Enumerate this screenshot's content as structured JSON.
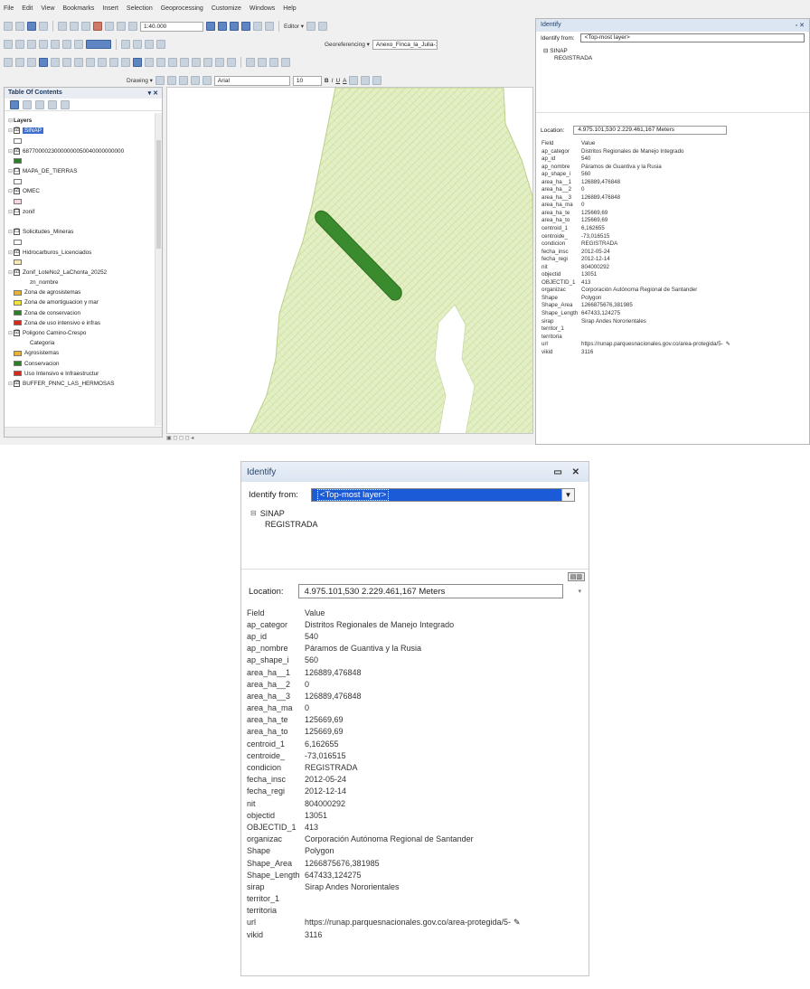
{
  "menu": [
    "File",
    "Edit",
    "View",
    "Bookmarks",
    "Insert",
    "Selection",
    "Geoprocessing",
    "Customize",
    "Windows",
    "Help"
  ],
  "toolbar": {
    "scale": "1:40.000",
    "editor_label": "Editor ▾",
    "georef_label": "Georeferencing ▾",
    "georef_layer": "Anexo_Finca_la_Julia-1",
    "drawing_label": "Drawing ▾",
    "font_name": "Arial",
    "font_size": "10"
  },
  "toc": {
    "title": "Table Of Contents",
    "pin": "▾ ✕",
    "rows": [
      {
        "exp": "⊟",
        "cb": "",
        "text": "Layers",
        "bold": true
      },
      {
        "exp": "⊟",
        "cb": "☑",
        "text": "SINAP",
        "highlight": true
      },
      {
        "exp": "",
        "sym": "#ffffff",
        "text": ""
      },
      {
        "exp": "⊟",
        "cb": "☑",
        "text": "68770000230000000050040000000000"
      },
      {
        "exp": "",
        "sym": "#2f7d2b",
        "text": ""
      },
      {
        "exp": "⊟",
        "cb": "☐",
        "text": "MAPA_DE_TIERRAS"
      },
      {
        "exp": "",
        "sym": "#ffffff",
        "text": ""
      },
      {
        "exp": "⊟",
        "cb": "☑",
        "text": "OMEC"
      },
      {
        "exp": "",
        "sym": "#f7d7e4",
        "text": ""
      },
      {
        "exp": "⊟",
        "cb": "☐",
        "text": "zonif"
      },
      {
        "exp": "",
        "text": ""
      },
      {
        "exp": "⊟",
        "cb": "☐",
        "text": "Solicitudes_Mineras"
      },
      {
        "exp": "",
        "sym": "#ffffff",
        "text": ""
      },
      {
        "exp": "⊟",
        "cb": "☑",
        "text": "Hidrocarburos_Licenciados"
      },
      {
        "exp": "",
        "sym": "#f6e7b5",
        "text": ""
      },
      {
        "exp": "⊟",
        "cb": "☑",
        "text": "Zonif_LoteNo2_LaChonta_20252"
      },
      {
        "exp": "",
        "text": "zn_nombre",
        "indent": true
      },
      {
        "exp": "",
        "sym": "#e8b23a",
        "text": "Zona de agrosistemas"
      },
      {
        "exp": "",
        "sym": "#f4e23a",
        "text": "Zona de amortiguacion y mar"
      },
      {
        "exp": "",
        "sym": "#2f7d2b",
        "text": "Zona de conservacion"
      },
      {
        "exp": "",
        "sym": "#d52a1e",
        "text": "Zona de uso intensivo e infras"
      },
      {
        "exp": "⊟",
        "cb": "☑",
        "text": "Poligono Camino-Crespo"
      },
      {
        "exp": "",
        "text": "Categoria",
        "indent": true
      },
      {
        "exp": "",
        "sym": "#e8b23a",
        "text": "Agrosistemas"
      },
      {
        "exp": "",
        "sym": "#2f7d2b",
        "text": "Conservacion"
      },
      {
        "exp": "",
        "sym": "#d52a1e",
        "text": "Uso Intensivo e Infraestructur"
      },
      {
        "exp": "⊟",
        "cb": "☑",
        "text": "BUFFER_PNNC_LAS_HERMOSAS"
      }
    ]
  },
  "map_status": "▣ ◻ ◻ ◻ ◂",
  "identify_small": {
    "title": "Identify",
    "controls": "▫ ✕",
    "from_label": "Identify from:",
    "from_value": "<Top-most layer>",
    "tree_layer": "SINAP",
    "tree_feature": "REGISTRADA",
    "location_label": "Location:",
    "location_value": "4.975.101,530  2.229.461,167 Meters",
    "header_field": "Field",
    "header_value": "Value"
  },
  "identify": {
    "title": "Identify",
    "controls": "▭ ✕",
    "from_label": "Identify from:",
    "from_value": "<Top-most layer>",
    "tree_layer": "SINAP",
    "tree_feature": "REGISTRADA",
    "panel_icons": "▤▥",
    "location_label": "Location:",
    "location_value": "4.975.101,530  2.229.461,167 Meters",
    "header_field": "Field",
    "header_value": "Value",
    "fields": [
      {
        "f": "ap_categor",
        "v": "Distritos Regionales de Manejo Integrado"
      },
      {
        "f": "ap_id",
        "v": "540"
      },
      {
        "f": "ap_nombre",
        "v": "Páramos de Guantiva y la Rusia"
      },
      {
        "f": "ap_shape_i",
        "v": "560"
      },
      {
        "f": "area_ha__1",
        "v": "126889,476848"
      },
      {
        "f": "area_ha__2",
        "v": "0"
      },
      {
        "f": "area_ha__3",
        "v": "126889,476848"
      },
      {
        "f": "area_ha_ma",
        "v": "0"
      },
      {
        "f": "area_ha_te",
        "v": "125669,69"
      },
      {
        "f": "area_ha_to",
        "v": "125669,69"
      },
      {
        "f": "centroid_1",
        "v": "6,162655"
      },
      {
        "f": "centroide_",
        "v": "-73,016515"
      },
      {
        "f": "condicion",
        "v": "REGISTRADA"
      },
      {
        "f": "fecha_insc",
        "v": "2012-05-24"
      },
      {
        "f": "fecha_regi",
        "v": "2012-12-14"
      },
      {
        "f": "nit",
        "v": "804000292"
      },
      {
        "f": "objectid",
        "v": "13051"
      },
      {
        "f": "OBJECTID_1",
        "v": "413"
      },
      {
        "f": "organizac",
        "v": "Corporación Autónoma Regional de Santander"
      },
      {
        "f": "Shape",
        "v": "Polygon"
      },
      {
        "f": "Shape_Area",
        "v": "1266875676,381985"
      },
      {
        "f": "Shape_Length",
        "v": "647433,124275"
      },
      {
        "f": "sirap",
        "v": "Sirap Andes Nororientales"
      },
      {
        "f": "territor_1",
        "v": ""
      },
      {
        "f": "territoria",
        "v": ""
      },
      {
        "f": "url",
        "v": "https://runap.parquesnacionales.gov.co/area-protegida/5-",
        "pen": "✎"
      },
      {
        "f": "vikid",
        "v": "3116"
      }
    ]
  },
  "colors": {
    "map_fill": "#e3efc4",
    "map_hatch": "#c8dc98",
    "polygon": "#3a8a2e",
    "selection": "#1c5bd8"
  }
}
